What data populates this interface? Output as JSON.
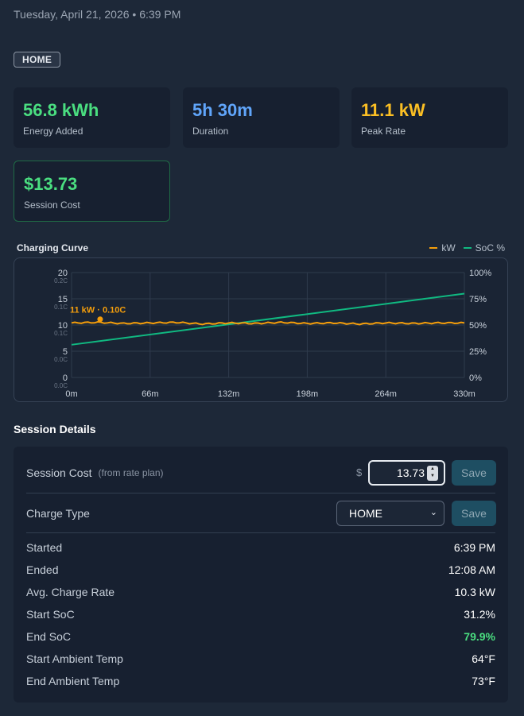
{
  "header": {
    "datetime": "Tuesday, April 21, 2026 • 6:39 PM",
    "tag": "HOME"
  },
  "stats": [
    {
      "value": "56.8 kWh",
      "label": "Energy Added",
      "color": "#4ade80"
    },
    {
      "value": "5h 30m",
      "label": "Duration",
      "color": "#60a5fa"
    },
    {
      "value": "11.1 kW",
      "label": "Peak Rate",
      "color": "#fbbf24"
    },
    {
      "value": "$13.73",
      "label": "Session Cost",
      "color": "#4ade80"
    }
  ],
  "chart": {
    "title": "Charging Curve",
    "legend_kw": "kW",
    "legend_soc": "SoC %",
    "annotation": "11 kW · 0.10C"
  },
  "chart_data": {
    "type": "line",
    "title": "Charging Curve",
    "x_ticks": [
      "0m",
      "66m",
      "132m",
      "198m",
      "264m",
      "330m"
    ],
    "xlim": [
      0,
      330
    ],
    "y_left_ticks": [
      "0",
      "5",
      "10",
      "15",
      "20"
    ],
    "y_left_sub_ticks": [
      "0.0C",
      "0.0C",
      "0.1C",
      "0.1C",
      "0.2C"
    ],
    "ylim_left": [
      0,
      20
    ],
    "y_right_ticks": [
      "0%",
      "25%",
      "50%",
      "75%",
      "100%"
    ],
    "ylim_right": [
      0,
      100
    ],
    "grid": true,
    "legend": "top-right",
    "series": [
      {
        "name": "kW",
        "axis": "left",
        "color": "#f59e0b",
        "x": [
          0,
          22,
          44,
          66,
          88,
          110,
          132,
          154,
          176,
          198,
          220,
          242,
          264,
          286,
          308,
          330
        ],
        "y": [
          10.4,
          10.5,
          10.3,
          10.4,
          10.5,
          10.2,
          10.4,
          10.3,
          10.5,
          10.3,
          10.4,
          10.2,
          10.4,
          10.3,
          10.4,
          10.4
        ]
      },
      {
        "name": "SoC %",
        "axis": "right",
        "color": "#10b981",
        "x": [
          0,
          330
        ],
        "y": [
          31.2,
          79.9
        ]
      }
    ],
    "peak_marker": {
      "x": 24,
      "y": 11.1
    }
  },
  "details": {
    "section_title": "Session Details",
    "cost_label": "Session Cost",
    "cost_sub": "(from rate plan)",
    "currency": "$",
    "cost_value": "13.73",
    "save_label": "Save",
    "type_label": "Charge Type",
    "type_value": "HOME",
    "rows": [
      {
        "k": "Started",
        "v": "6:39 PM"
      },
      {
        "k": "Ended",
        "v": "12:08 AM"
      },
      {
        "k": "Avg. Charge Rate",
        "v": "10.3 kW"
      },
      {
        "k": "Start SoC",
        "v": "31.2%"
      },
      {
        "k": "End SoC",
        "v": "79.9%"
      },
      {
        "k": "Start Ambient Temp",
        "v": "64°F"
      },
      {
        "k": "End Ambient Temp",
        "v": "73°F"
      }
    ]
  }
}
